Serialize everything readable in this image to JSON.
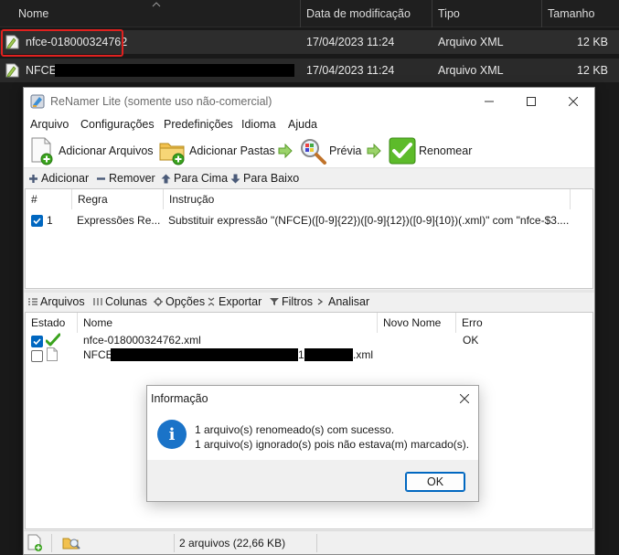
{
  "explorer": {
    "columns": {
      "name": "Nome",
      "modified": "Data de modificação",
      "type": "Tipo",
      "size": "Tamanho"
    },
    "rows": [
      {
        "name": "nfce-018000324762",
        "modified": "17/04/2023 11:24",
        "type": "Arquivo XML",
        "size": "12 KB"
      },
      {
        "name": "NFCE",
        "modified": "17/04/2023 11:24",
        "type": "Arquivo XML",
        "size": "12 KB"
      }
    ]
  },
  "window": {
    "title": "ReNamer Lite (somente uso não-comercial)",
    "menu": [
      "Arquivo",
      "Configurações",
      "Predefinições",
      "Idioma",
      "Ajuda"
    ],
    "toolbar": {
      "add_files": "Adicionar Arquivos",
      "add_folders": "Adicionar Pastas",
      "preview": "Prévia",
      "rename": "Renomear"
    },
    "rules_bar": {
      "add": "Adicionar",
      "remove": "Remover",
      "up": "Para Cima",
      "down": "Para Baixo"
    },
    "rules_grid": {
      "headers": [
        "#",
        "Regra",
        "Instrução"
      ],
      "rows": [
        {
          "num": "1",
          "rule": "Expressões Re...",
          "instruction": "Substituir expressão \"(NFCE)([0-9]{22})([0-9]{12})([0-9]{10})(.xml)\" com \"nfce-$3...."
        }
      ]
    },
    "files_bar": {
      "files": "Arquivos",
      "columns": "Colunas",
      "options": "Opções",
      "export": "Exportar",
      "filters": "Filtros",
      "analyze": "Analisar"
    },
    "files_grid": {
      "headers": [
        "Estado",
        "Nome",
        "Novo Nome",
        "Erro"
      ],
      "rows": [
        {
          "name": "nfce-018000324762.xml",
          "new_name": "",
          "error": "OK",
          "checked": true
        },
        {
          "name_prefix": "NFCE",
          "name_mid": "1",
          "name_suffix": ".xml",
          "new_name": "",
          "error": "",
          "checked": false
        }
      ]
    },
    "status": {
      "count": "2 arquivos (22,66 KB)"
    }
  },
  "dialog": {
    "title": "Informação",
    "line1": "1 arquivo(s) renomeado(s) com sucesso.",
    "line2": "1 arquivo(s) ignorado(s) pois não estava(m) marcado(s).",
    "ok": "OK"
  },
  "colors": {
    "highlight_border": "#e0211f",
    "accent": "#0067c0",
    "info_icon": "#1a73c8",
    "check_green": "#3aa31e"
  }
}
